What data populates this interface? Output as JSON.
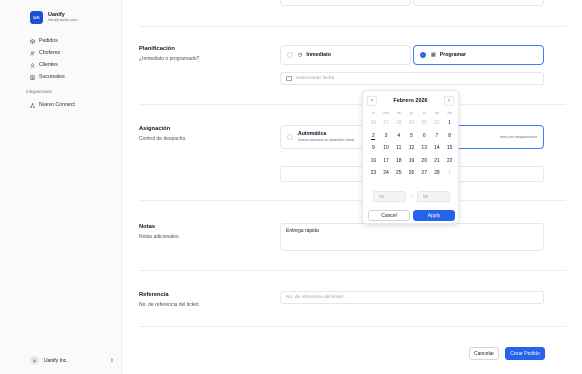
{
  "brand": {
    "initials": "UA",
    "name": "Uanify",
    "email": "info@uanify.com"
  },
  "nav": [
    {
      "label": "Pedidos",
      "icon": "box-icon"
    },
    {
      "label": "Choferes",
      "icon": "users-icon"
    },
    {
      "label": "Clientes",
      "icon": "user-icon"
    },
    {
      "label": "Sucursales",
      "icon": "store-icon"
    }
  ],
  "integrations": {
    "heading": "Integraciones",
    "items": [
      {
        "label": "Nuevo Connect",
        "icon": "network-icon"
      }
    ]
  },
  "org": {
    "initials": "UI",
    "name": "Uanify Inc.",
    "chevron": "⇕"
  },
  "planning": {
    "title": "Planificación",
    "desc": "¿Inmediato o programado?",
    "opt_immediate": "Inmediato",
    "opt_scheduled": "Programar",
    "date_placeholder": "Seleccionar fecha"
  },
  "assignment": {
    "title": "Asignación",
    "desc": "Control de despacho.",
    "opt_auto": "Automática",
    "opt_auto_desc": "Nuevo buscará al repartidor ideal.",
    "opt_manual_desc": "ente por despachador"
  },
  "notes": {
    "title": "Notas",
    "desc": "Notas adicionales.",
    "value": "Entrega rápida"
  },
  "reference": {
    "title": "Referencia",
    "desc": "No. de referencia del ticket.",
    "placeholder": "No. de referencia del ticket..."
  },
  "footer": {
    "cancel": "Cancelar",
    "submit": "Crear Pedido"
  },
  "calendar": {
    "month_label": "Febrero 2026",
    "prev": "‹",
    "next": "›",
    "weekdays": [
      "lu",
      "ma",
      "mi",
      "ju",
      "vi",
      "sá",
      "do"
    ],
    "days": [
      "26",
      "27",
      "28",
      "29",
      "30",
      "31",
      "1",
      "2",
      "3",
      "4",
      "5",
      "6",
      "7",
      "8",
      "9",
      "10",
      "11",
      "12",
      "13",
      "14",
      "15",
      "16",
      "17",
      "18",
      "19",
      "20",
      "21",
      "22",
      "23",
      "24",
      "25",
      "26",
      "27",
      "28",
      "1"
    ],
    "outside_indices": [
      0,
      1,
      2,
      3,
      4,
      5,
      34
    ],
    "today_index": 7,
    "hour_placeholder": "00",
    "minute_placeholder": "00",
    "time_separator": ":",
    "cancel": "Cancel",
    "apply": "Apply"
  }
}
